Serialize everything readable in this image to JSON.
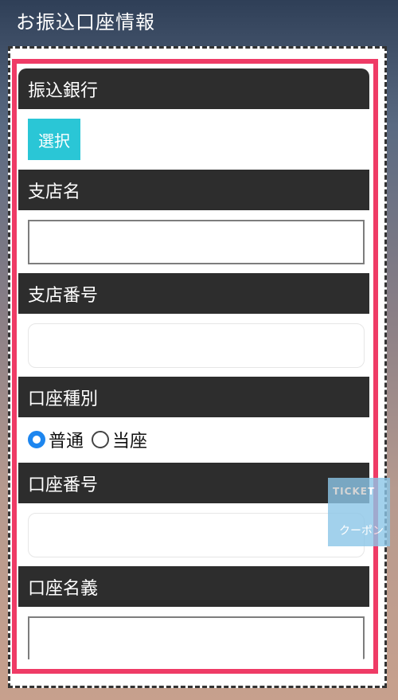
{
  "page": {
    "title": "お振込口座情報"
  },
  "form": {
    "bank": {
      "label": "振込銀行",
      "select_button": "選択"
    },
    "branch_name": {
      "label": "支店名",
      "value": ""
    },
    "branch_number": {
      "label": "支店番号",
      "value": ""
    },
    "account_type": {
      "label": "口座種別",
      "options": [
        {
          "label": "普通",
          "selected": true
        },
        {
          "label": "当座",
          "selected": false
        }
      ]
    },
    "account_number": {
      "label": "口座番号",
      "value": ""
    },
    "account_holder": {
      "label": "口座名義",
      "value": ""
    }
  },
  "floating": {
    "ticket_text": "TICKET",
    "coupon_text": "クーポン"
  },
  "colors": {
    "accent": "#2ac6d6",
    "frame": "#ef3b66",
    "radio": "#1d86ef",
    "header": "#2d2d2d"
  }
}
